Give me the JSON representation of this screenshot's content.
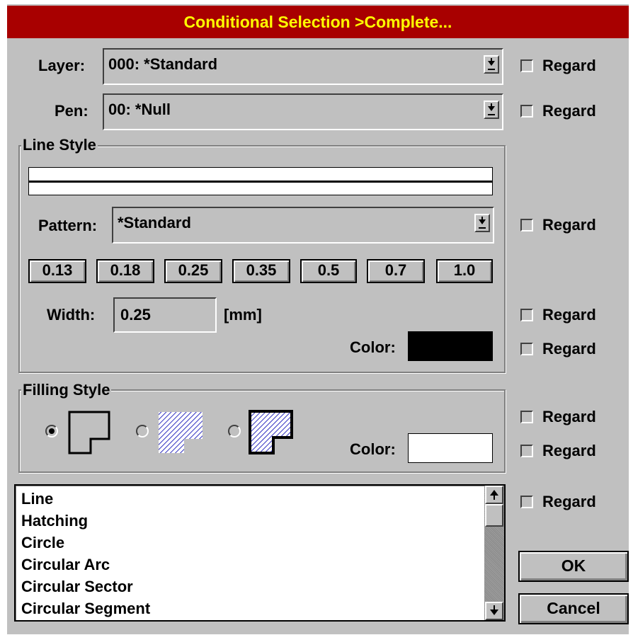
{
  "title": "Conditional Selection >Complete...",
  "layer": {
    "label": "Layer:",
    "value": "000: *Standard"
  },
  "pen": {
    "label": "Pen:",
    "value": "00: *Null"
  },
  "regard_label": "Regard",
  "line_style": {
    "group_title": "Line Style",
    "pattern_label": "Pattern:",
    "pattern_value": "*Standard",
    "width_presets": [
      "0.13",
      "0.18",
      "0.25",
      "0.35",
      "0.5",
      "0.7",
      "1.0"
    ],
    "width_label": "Width:",
    "width_value": "0.25",
    "width_unit": "[mm]",
    "color_label": "Color:",
    "color": "#000000"
  },
  "filling_style": {
    "group_title": "Filling Style",
    "options": [
      "empty",
      "hatched",
      "hatched-outlined"
    ],
    "selected": 0,
    "color_label": "Color:",
    "color": "#ffffff"
  },
  "element_types": [
    "Line",
    "Hatching",
    "Circle",
    "Circular Arc",
    "Circular Sector",
    "Circular Segment"
  ],
  "buttons": {
    "ok": "OK",
    "cancel": "Cancel"
  },
  "colors": {
    "titlebar": "#a80000",
    "title_text": "#ffff00",
    "dialog_bg": "#c0c0c0"
  },
  "icons": {
    "dropdown": "dropdown-arrow-icon",
    "scroll_up": "scroll-up-arrow-icon",
    "scroll_down": "scroll-down-arrow-icon"
  }
}
